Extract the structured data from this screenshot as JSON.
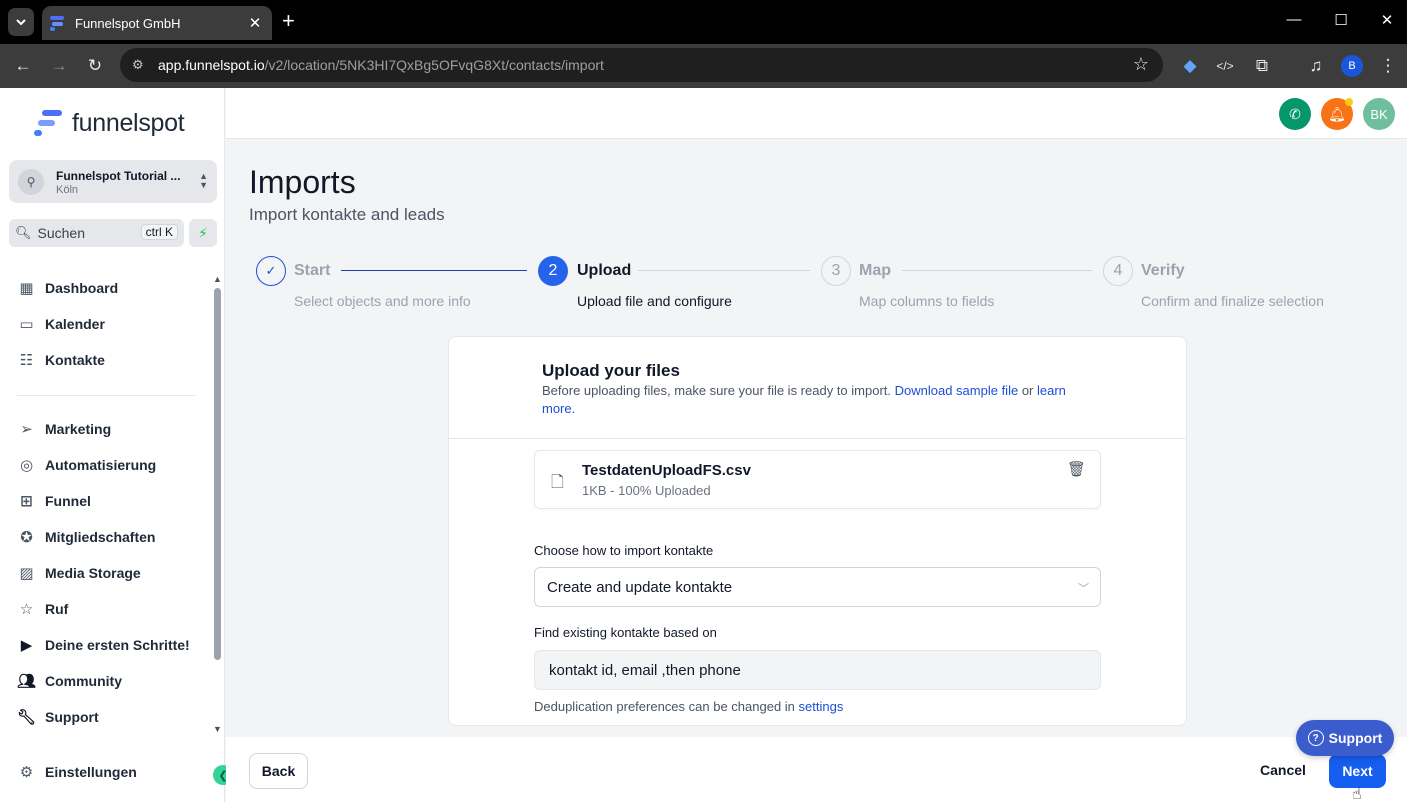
{
  "browser": {
    "tab_title": "Funnelspot GmbH",
    "url_host": "app.funnelspot.io",
    "url_path": "/v2/location/5NK3HI7QxBg5OFvqG8Xt/contacts/import",
    "profile_initial": "B"
  },
  "sidebar": {
    "brand": "funnelspot",
    "account_name": "Funnelspot Tutorial ...",
    "account_city": "Köln",
    "search_placeholder": "Suchen",
    "search_shortcut": "ctrl K",
    "nav_top": [
      {
        "label": "Dashboard",
        "icon": "dashboard-icon"
      },
      {
        "label": "Kalender",
        "icon": "calendar-icon"
      },
      {
        "label": "Kontakte",
        "icon": "contacts-icon"
      }
    ],
    "nav_main": [
      {
        "label": "Marketing",
        "icon": "send-icon"
      },
      {
        "label": "Automatisierung",
        "icon": "automation-icon"
      },
      {
        "label": "Funnel",
        "icon": "funnel-icon"
      },
      {
        "label": "Mitgliedschaften",
        "icon": "membership-icon"
      },
      {
        "label": "Media Storage",
        "icon": "image-icon"
      },
      {
        "label": "Ruf",
        "icon": "star-icon"
      },
      {
        "label": "Deine ersten Schritte!",
        "icon": "play-icon"
      },
      {
        "label": "Community",
        "icon": "community-icon"
      },
      {
        "label": "Support",
        "icon": "wrench-icon"
      }
    ],
    "settings_label": "Einstellungen"
  },
  "header": {
    "avatar_initials": "BK",
    "colors": {
      "phone": "#059669",
      "bell": "#f97316",
      "avatar": "#6fbf9f"
    }
  },
  "main": {
    "title": "Imports",
    "subtitle": "Import kontakte and leads",
    "steps": [
      {
        "marker": "✓",
        "title": "Start",
        "desc": "Select objects and more info",
        "state": "done"
      },
      {
        "marker": "2",
        "title": "Upload",
        "desc": "Upload file and configure",
        "state": "active"
      },
      {
        "marker": "3",
        "title": "Map",
        "desc": "Map columns to fields",
        "state": "pending"
      },
      {
        "marker": "4",
        "title": "Verify",
        "desc": "Confirm and finalize selection",
        "state": "pending"
      }
    ],
    "card": {
      "title": "Upload your files",
      "desc_prefix": "Before uploading files, make sure your file is ready to import. ",
      "sample_link": "Download sample file",
      "desc_or": " or ",
      "learn_link": "learn more.",
      "file_name": "TestdatenUploadFS.csv",
      "file_meta": "1KB - 100% Uploaded",
      "import_label": "Choose how to import kontakte",
      "import_value": "Create and update kontakte",
      "find_label": "Find existing kontakte based on",
      "find_value": "kontakt id, email ,then phone",
      "dedup_text": "Deduplication preferences can be changed in ",
      "dedup_link": "settings"
    }
  },
  "footer": {
    "back": "Back",
    "cancel": "Cancel",
    "next": "Next",
    "support": "Support"
  },
  "colors": {
    "primary": "#155eef",
    "step_active": "#2563eb",
    "step_done_line": "#1e40af"
  }
}
